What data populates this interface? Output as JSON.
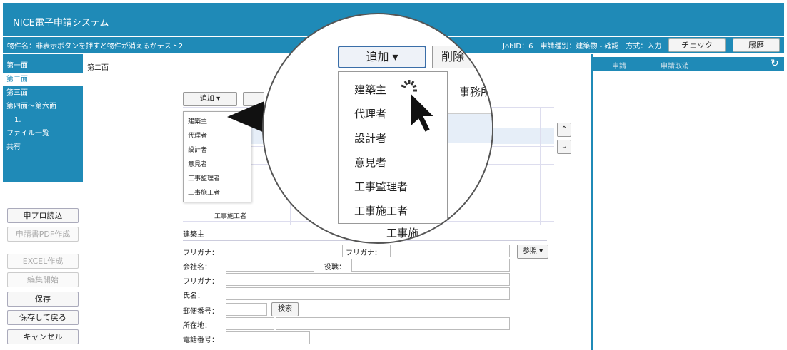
{
  "app": {
    "title": "NICE電子申請システム"
  },
  "info": {
    "property_name": "物件名：非表示ボタンを押すと物件が消えるかテスト2",
    "job_info": "JobID：6　申請種別：建築物 - 確認　方式：入力",
    "check_label": "チェック",
    "history_label": "履歴"
  },
  "nav": {
    "items": [
      "第一面",
      "第二面",
      "第三面",
      "第四面～第六面",
      "1.",
      "ファイル一覧",
      "共有"
    ]
  },
  "left_buttons": {
    "import": "申プロ読込",
    "pdf": "申請書PDF作成",
    "excel": "EXCEL作成",
    "edit_start": "編集開始",
    "save": "保存",
    "save_back": "保存して戻る",
    "cancel": "キャンセル"
  },
  "main": {
    "breadcrumb": "第二面",
    "add_label": "追加 ▾",
    "section_title": "建築主",
    "row_label": "工事施工者",
    "menu_items": [
      "建築主",
      "代理者",
      "設計者",
      "意見者",
      "工事監理者",
      "工事施工者"
    ],
    "form": {
      "furigana1": "フリガナ：",
      "furigana2": "フリガナ：",
      "company": "会社名：",
      "position": "役職：",
      "furigana3": "フリガナ：",
      "name": "氏名：",
      "postal": "郵便番号：",
      "search": "検索",
      "address": "所在地：",
      "phone": "電話番号：",
      "ref": "参照 ▾"
    }
  },
  "right": {
    "tab_apply": "申請",
    "tab_cancel": "申請取消"
  },
  "magnifier": {
    "add_label": "追加 ▾",
    "delete_label": "削除",
    "header_label": "事務所",
    "menu_items": [
      "建築主",
      "代理者",
      "設計者",
      "意見者",
      "工事監理者",
      "工事施工者"
    ],
    "bottom_label": "工事施"
  }
}
